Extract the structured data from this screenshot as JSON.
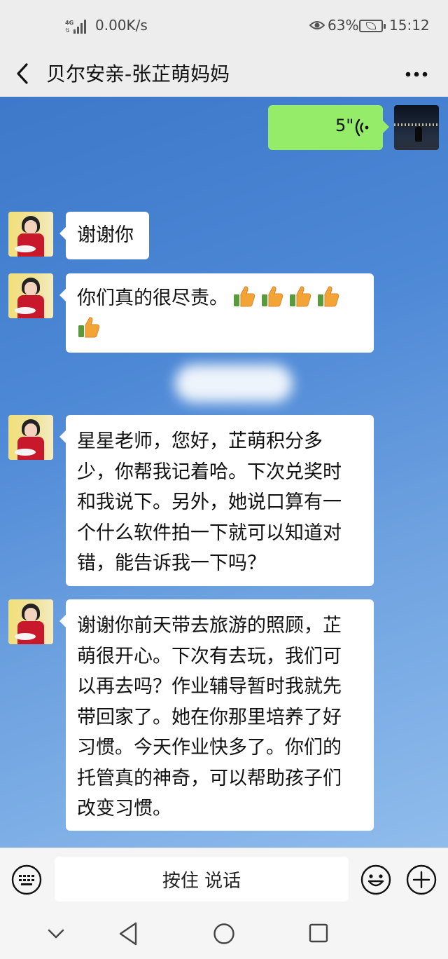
{
  "status_bar": {
    "network": "4G",
    "speed": "0.00K/s",
    "battery": "63%",
    "time": "15:12"
  },
  "header": {
    "title": "贝尔安亲-张芷萌妈妈",
    "back_icon": "chevron-left-icon",
    "more_icon": "more-dots-icon"
  },
  "messages": [
    {
      "sender": "self",
      "type": "voice",
      "duration": "5\""
    },
    {
      "sender": "other",
      "type": "text",
      "text": "谢谢你"
    },
    {
      "sender": "other",
      "type": "text",
      "text": "你们真的很尽责。",
      "emoji": [
        "thumbs-up",
        "thumbs-up",
        "thumbs-up",
        "thumbs-up",
        "thumbs-up"
      ]
    },
    {
      "sender": "other",
      "type": "text",
      "lines": [
        "星星老师，您好，芷萌积分多",
        "少，你帮我记着哈。下次兑奖时",
        "和我说下。另外，她说口算有一",
        "个什么软件拍一下就可以知道对",
        "错，能告诉我一下吗？"
      ]
    },
    {
      "sender": "other",
      "type": "text",
      "lines": [
        "谢谢你前天带去旅游的照顾，芷",
        "萌很开心。下次有去玩，我们可",
        "以再去吗？作业辅导暂时我就先",
        "带回家了。她在你那里培养了好",
        "习惯。今天作业快多了。你们的",
        "托管真的神奇，可以帮助孩子们",
        "改变习惯。"
      ]
    }
  ],
  "input_bar": {
    "hold_to_talk": "按住 说话",
    "keyboard_icon": "keyboard-icon",
    "emoji_icon": "smiley-icon",
    "plus_icon": "plus-icon"
  },
  "nav_bar": {
    "icons": [
      "chevron-down-icon",
      "triangle-back-icon",
      "circle-home-icon",
      "square-recents-icon"
    ]
  },
  "colors": {
    "self_bubble": "#95ec69",
    "other_bubble": "#ffffff",
    "chat_background": "#4d88d6",
    "chrome": "#ededed"
  }
}
